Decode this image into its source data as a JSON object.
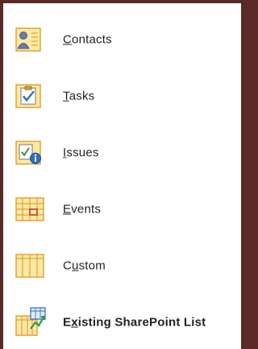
{
  "menu": {
    "items": [
      {
        "key": "contacts",
        "label": "Contacts",
        "mnemonic_index": 0,
        "icon": "contacts-icon"
      },
      {
        "key": "tasks",
        "label": "Tasks",
        "mnemonic_index": 0,
        "icon": "tasks-icon"
      },
      {
        "key": "issues",
        "label": "Issues",
        "mnemonic_index": 0,
        "icon": "issues-icon"
      },
      {
        "key": "events",
        "label": "Events",
        "mnemonic_index": 0,
        "icon": "events-icon"
      },
      {
        "key": "custom",
        "label": "Custom",
        "mnemonic_index": 1,
        "icon": "custom-table-icon"
      },
      {
        "key": "existing-sharepoint",
        "label": "Existing SharePoint List",
        "mnemonic_index": 1,
        "icon": "sharepoint-list-icon"
      }
    ]
  },
  "colors": {
    "frame": "#5a2a26",
    "icon_fill": "#fde9a4",
    "icon_border": "#e0a33a",
    "accent_blue": "#2f6fc1",
    "accent_green": "#2e9a3a",
    "accent_red": "#c23b2b"
  }
}
